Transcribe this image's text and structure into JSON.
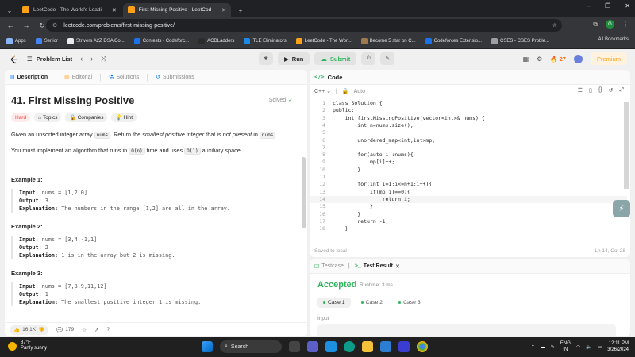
{
  "browser": {
    "tabs": [
      {
        "title": "LeetCode - The World's Leadi",
        "active": false
      },
      {
        "title": "First Missing Positive - LeetCod",
        "active": true
      }
    ],
    "url": "leetcode.com/problems/first-missing-positive/",
    "profile_letter": "G",
    "bookmarks": [
      "Apps",
      "Senior",
      "Strivers A2Z DSA Co...",
      "Contests - Codeforc...",
      "ACDLadders",
      "TLE Eliminators",
      "LeetCode - The Wor...",
      "Become 5 star on C...",
      "Codeforces Extensio...",
      "CSES - CSES Proble..."
    ],
    "all_bookmarks": "All Bookmarks",
    "bookmark_colors": [
      "#8ab4f8",
      "#4285f4",
      "#e8eaed",
      "#1a73e8",
      "#2b2b2b",
      "#1e88e5",
      "#ffa116",
      "#9e7a4c",
      "#1a73e8",
      "#9aa0a6"
    ]
  },
  "topbar": {
    "problem_list": "Problem List",
    "run": "Run",
    "submit": "Submit",
    "streak": "27",
    "premium": "Premium"
  },
  "left": {
    "tabs": [
      "Description",
      "Editorial",
      "Solutions",
      "Submissions"
    ],
    "title": "41. First Missing Positive",
    "solved": "Solved",
    "badges": [
      "Hard",
      "Topics",
      "Companies",
      "Hint"
    ],
    "desc1": {
      "a": "Given an unsorted integer array ",
      "code": "nums",
      "b": ". Return the ",
      "em1": "smallest positive integer",
      "c": " that is ",
      "em2": "not present",
      "d": " in ",
      "code2": "nums",
      "e": "."
    },
    "desc2": {
      "a": "You must implement an algorithm that runs in ",
      "code": "O(n)",
      "b": " time and uses ",
      "code2": "O(1)",
      "c": " auxiliary space."
    },
    "examples": [
      {
        "heading": "Example 1:",
        "input": "nums = [1,2,0]",
        "output": "3",
        "explanation": "The numbers in the range [1,2] are all in the array."
      },
      {
        "heading": "Example 2:",
        "input": "nums = [3,4,-1,1]",
        "output": "2",
        "explanation": "1 is in the array but 2 is missing."
      },
      {
        "heading": "Example 3:",
        "input": "nums = [7,8,9,11,12]",
        "output": "1",
        "explanation": "The smallest positive integer 1 is missing."
      }
    ],
    "labels": {
      "input": "Input:",
      "output": "Output:",
      "explanation": "Explanation:"
    },
    "likes": "16.1K",
    "comments": "179"
  },
  "code": {
    "header": "Code",
    "language": "C++",
    "mode": "Auto",
    "lines": [
      "class Solution {",
      "public:",
      "    int firstMissingPositive(vector<int>& nums) {",
      "        int n=nums.size();",
      "",
      "        unordered_map<int,int>mp;",
      "",
      "        for(auto i :nums){",
      "            mp[i]++;",
      "        }",
      "",
      "        for(int i=1;i<=n+1;i++){",
      "            if(mp[i]==0){",
      "                return i;",
      "            }",
      "        }",
      "        return -1;",
      "    }"
    ],
    "saved": "Saved to local",
    "position": "Ln 14, Col 28"
  },
  "result": {
    "tabs": [
      "Testcase",
      "Test Result"
    ],
    "status": "Accepted",
    "runtime": "Runtime: 3 ms",
    "cases": [
      "Case 1",
      "Case 2",
      "Case 3"
    ],
    "input_label": "Input"
  },
  "taskbar": {
    "temp": "87°F",
    "weather": "Partly sunny",
    "weather_badge": "1",
    "search": "Search",
    "lang": "ENG",
    "region": "IN",
    "time": "12:11 PM",
    "date": "3/26/2024"
  }
}
